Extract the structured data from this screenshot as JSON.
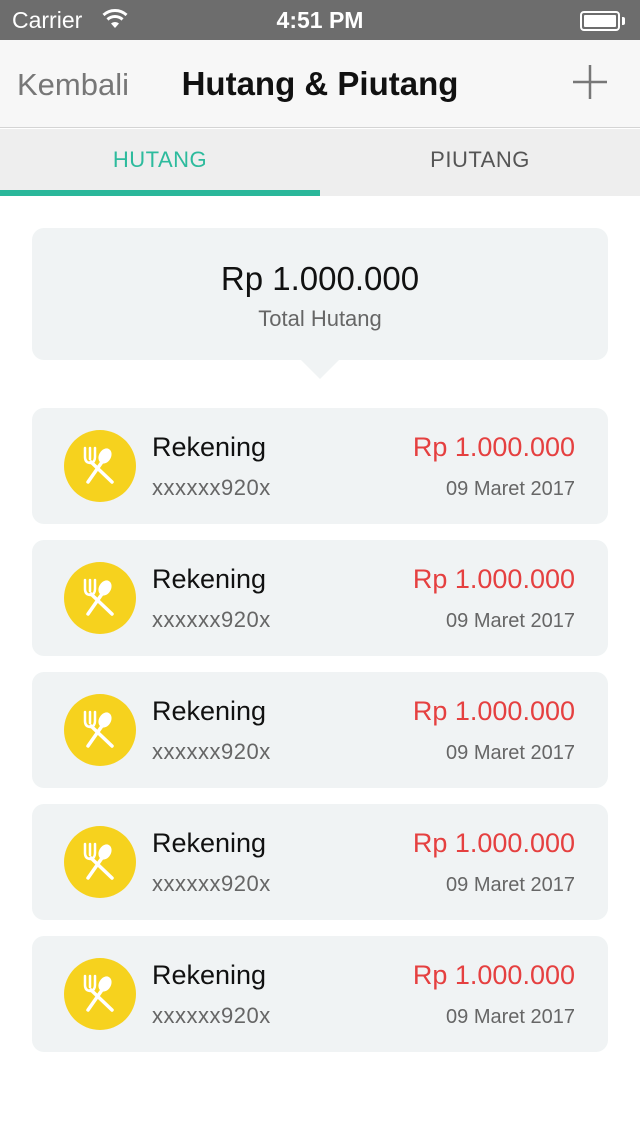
{
  "status_bar": {
    "carrier": "Carrier",
    "time": "4:51 PM",
    "wifi_icon": "wifi-icon",
    "battery_icon": "battery-icon"
  },
  "nav": {
    "back_label": "Kembali",
    "title": "Hutang & Piutang",
    "add_icon": "plus-icon"
  },
  "tabs": [
    {
      "label": "HUTANG",
      "active": true
    },
    {
      "label": "PIUTANG",
      "active": false
    }
  ],
  "summary": {
    "amount": "Rp 1.000.000",
    "label": "Total Hutang"
  },
  "colors": {
    "accent": "#2ab79a",
    "amount_red": "#e54040",
    "avatar_yellow": "#f6d21e",
    "card_bg": "#f0f3f4"
  },
  "items": [
    {
      "icon": "fork-spoon-icon",
      "name": "Rekening",
      "account": "xxxxxx920x",
      "amount": "Rp 1.000.000",
      "date": "09 Maret 2017"
    },
    {
      "icon": "fork-spoon-icon",
      "name": "Rekening",
      "account": "xxxxxx920x",
      "amount": "Rp 1.000.000",
      "date": "09 Maret 2017"
    },
    {
      "icon": "fork-spoon-icon",
      "name": "Rekening",
      "account": "xxxxxx920x",
      "amount": "Rp 1.000.000",
      "date": "09 Maret 2017"
    },
    {
      "icon": "fork-spoon-icon",
      "name": "Rekening",
      "account": "xxxxxx920x",
      "amount": "Rp 1.000.000",
      "date": "09 Maret 2017"
    },
    {
      "icon": "fork-spoon-icon",
      "name": "Rekening",
      "account": "xxxxxx920x",
      "amount": "Rp 1.000.000",
      "date": "09 Maret 2017"
    }
  ]
}
